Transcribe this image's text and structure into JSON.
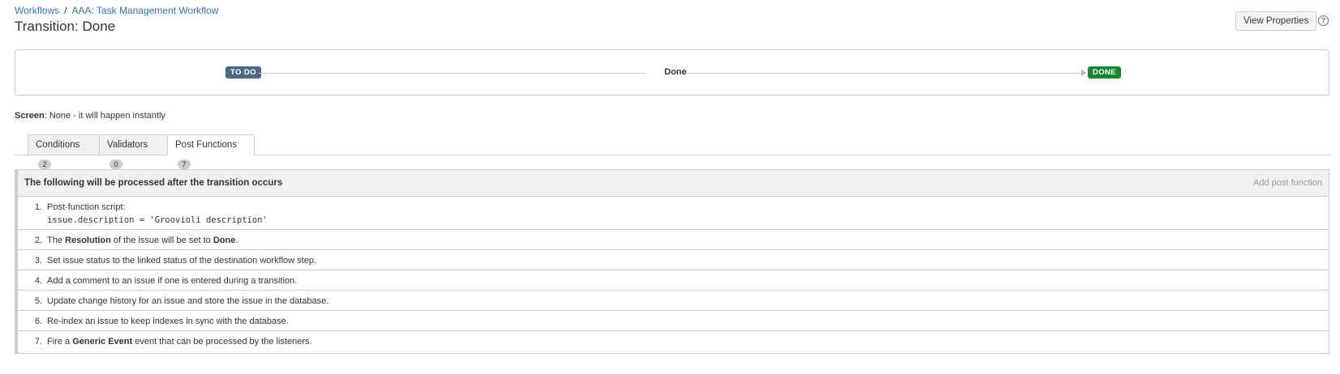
{
  "breadcrumb": {
    "workflows": "Workflows",
    "separator": "/",
    "workflow_name": "AAA: Task Management Workflow"
  },
  "page_title": "Transition: Done",
  "header": {
    "view_properties": "View Properties",
    "help_icon": "?"
  },
  "diagram": {
    "from_status": "TO DO",
    "transition": "Done",
    "to_status": "DONE"
  },
  "screen": {
    "label": "Screen",
    "value": ": None - it will happen instantly"
  },
  "tabs": [
    {
      "label": "Conditions",
      "count": "2"
    },
    {
      "label": "Validators",
      "count": "0"
    },
    {
      "label": "Post Functions",
      "count": "7"
    }
  ],
  "panel": {
    "title": "The following will be processed after the transition occurs",
    "add_label": "Add post function"
  },
  "post_functions": [
    {
      "num": "1.",
      "text": "Post-function script:",
      "code": "issue.description = 'Groovioli description'"
    },
    {
      "num": "2.",
      "pre": "The ",
      "b1": "Resolution",
      "mid": " of the issue will be set to ",
      "b2": "Done",
      "post": "."
    },
    {
      "num": "3.",
      "text": "Set issue status to the linked status of the destination workflow step."
    },
    {
      "num": "4.",
      "text": "Add a comment to an issue if one is entered during a transition."
    },
    {
      "num": "5.",
      "text": "Update change history for an issue and store the issue in the database."
    },
    {
      "num": "6.",
      "text": "Re-index an issue to keep indexes in sync with the database."
    },
    {
      "num": "7.",
      "pre": "Fire a ",
      "b1": "Generic Event",
      "post": " event that can be processed by the listeners."
    }
  ],
  "colors": {
    "todo_lozenge": "#4a6785",
    "done_lozenge": "#14892c",
    "link": "#3572b0"
  }
}
